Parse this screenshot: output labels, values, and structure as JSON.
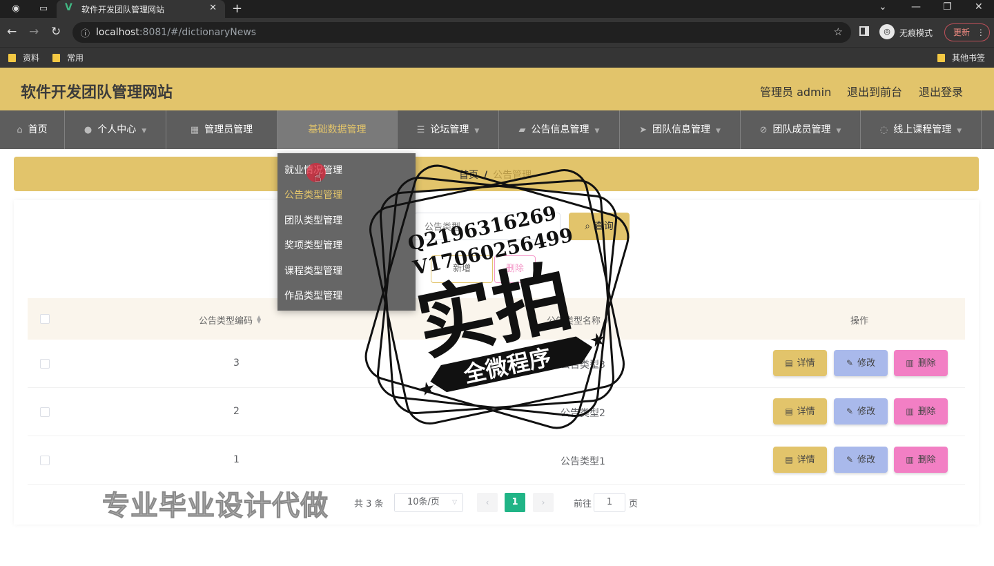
{
  "browser": {
    "tab_title": "软件开发团队管理网站",
    "url_host": "localhost",
    "url_rest": ":8081/#/dictionaryNews",
    "incognito_label": "无痕模式",
    "update_label": "更新",
    "bookmarks": [
      "资料",
      "常用"
    ],
    "other_bookmarks": "其他书签"
  },
  "header": {
    "site_title": "软件开发团队管理网站",
    "admin_label": "管理员 admin",
    "front_link": "退出到前台",
    "logout_link": "退出登录"
  },
  "nav": {
    "items": [
      {
        "label": "首页"
      },
      {
        "label": "个人中心"
      },
      {
        "label": "管理员管理"
      },
      {
        "label": "基础数据管理"
      },
      {
        "label": "论坛管理"
      },
      {
        "label": "公告信息管理"
      },
      {
        "label": "团队信息管理"
      },
      {
        "label": "团队成员管理"
      },
      {
        "label": "线上课程管理"
      }
    ],
    "dropdown": [
      "就业情况管理",
      "公告类型管理",
      "团队类型管理",
      "奖项类型管理",
      "课程类型管理",
      "作品类型管理"
    ]
  },
  "breadcrumb": {
    "home": "首页",
    "separator": "/",
    "current": "公告管理"
  },
  "search": {
    "placeholder": "公告类型",
    "query_label": "查询",
    "add_label": "新增",
    "delete_label": "删除"
  },
  "table": {
    "columns": {
      "code": "公告类型编码",
      "name": "公告类型名称",
      "actions": "操作"
    },
    "rows": [
      {
        "code": "3",
        "name": "公告类型3"
      },
      {
        "code": "2",
        "name": "公告类型2"
      },
      {
        "code": "1",
        "name": "公告类型1"
      }
    ],
    "actions": {
      "detail": "详情",
      "edit": "修改",
      "delete": "删除"
    }
  },
  "pagination": {
    "total": "共 3 条",
    "page_size": "10条/页",
    "current": "1",
    "goto_label": "前往",
    "goto_value": "1",
    "page_suffix": "页"
  },
  "watermark": {
    "line1": "Q2196316269",
    "line2": "V17060256499",
    "big": "实拍",
    "banner": "全微程序",
    "bottom": "专业毕业设计代做"
  },
  "colors": {
    "accent": "#e2c46b",
    "nav_bg": "#5d5d5d",
    "edit": "#a9b9eb",
    "delete": "#f27fc4",
    "page_active": "#20b486"
  }
}
